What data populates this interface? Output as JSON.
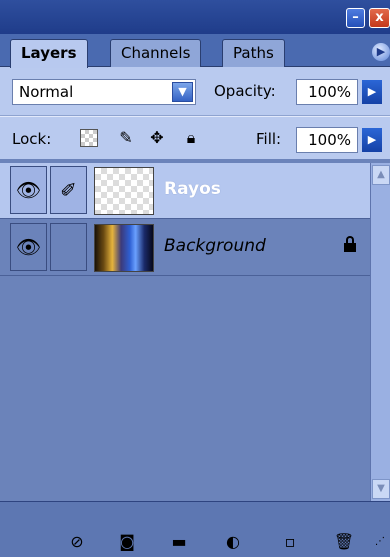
{
  "window": {
    "minimize_icon": "minimize-icon",
    "close_icon": "close-icon",
    "minimize_glyph": "–",
    "close_glyph": "x"
  },
  "tabs": [
    {
      "label": "Layers",
      "active": true
    },
    {
      "label": "Channels",
      "active": false
    },
    {
      "label": "Paths",
      "active": false
    }
  ],
  "tab_menu_glyph": "▶",
  "options": {
    "blend_mode": "Normal",
    "opacity_label": "Opacity:",
    "opacity_value": "100%",
    "lock_label": "Lock:",
    "fill_label": "Fill:",
    "fill_value": "100%"
  },
  "layers": [
    {
      "name": "Rayos",
      "selected": true,
      "visible": true,
      "locked": false
    },
    {
      "name": "Background",
      "selected": false,
      "visible": true,
      "locked": true
    }
  ],
  "toolbar_icons": [
    "link-layers-icon",
    "layer-mask-icon",
    "new-group-icon",
    "adjustment-layer-icon",
    "new-layer-icon",
    "delete-layer-icon"
  ],
  "colors": {
    "titlebar": "#1f3c8a",
    "panel_background": "#6b83ba",
    "options_background": "#b9caef",
    "selected_layer": "#b5c7ef"
  }
}
